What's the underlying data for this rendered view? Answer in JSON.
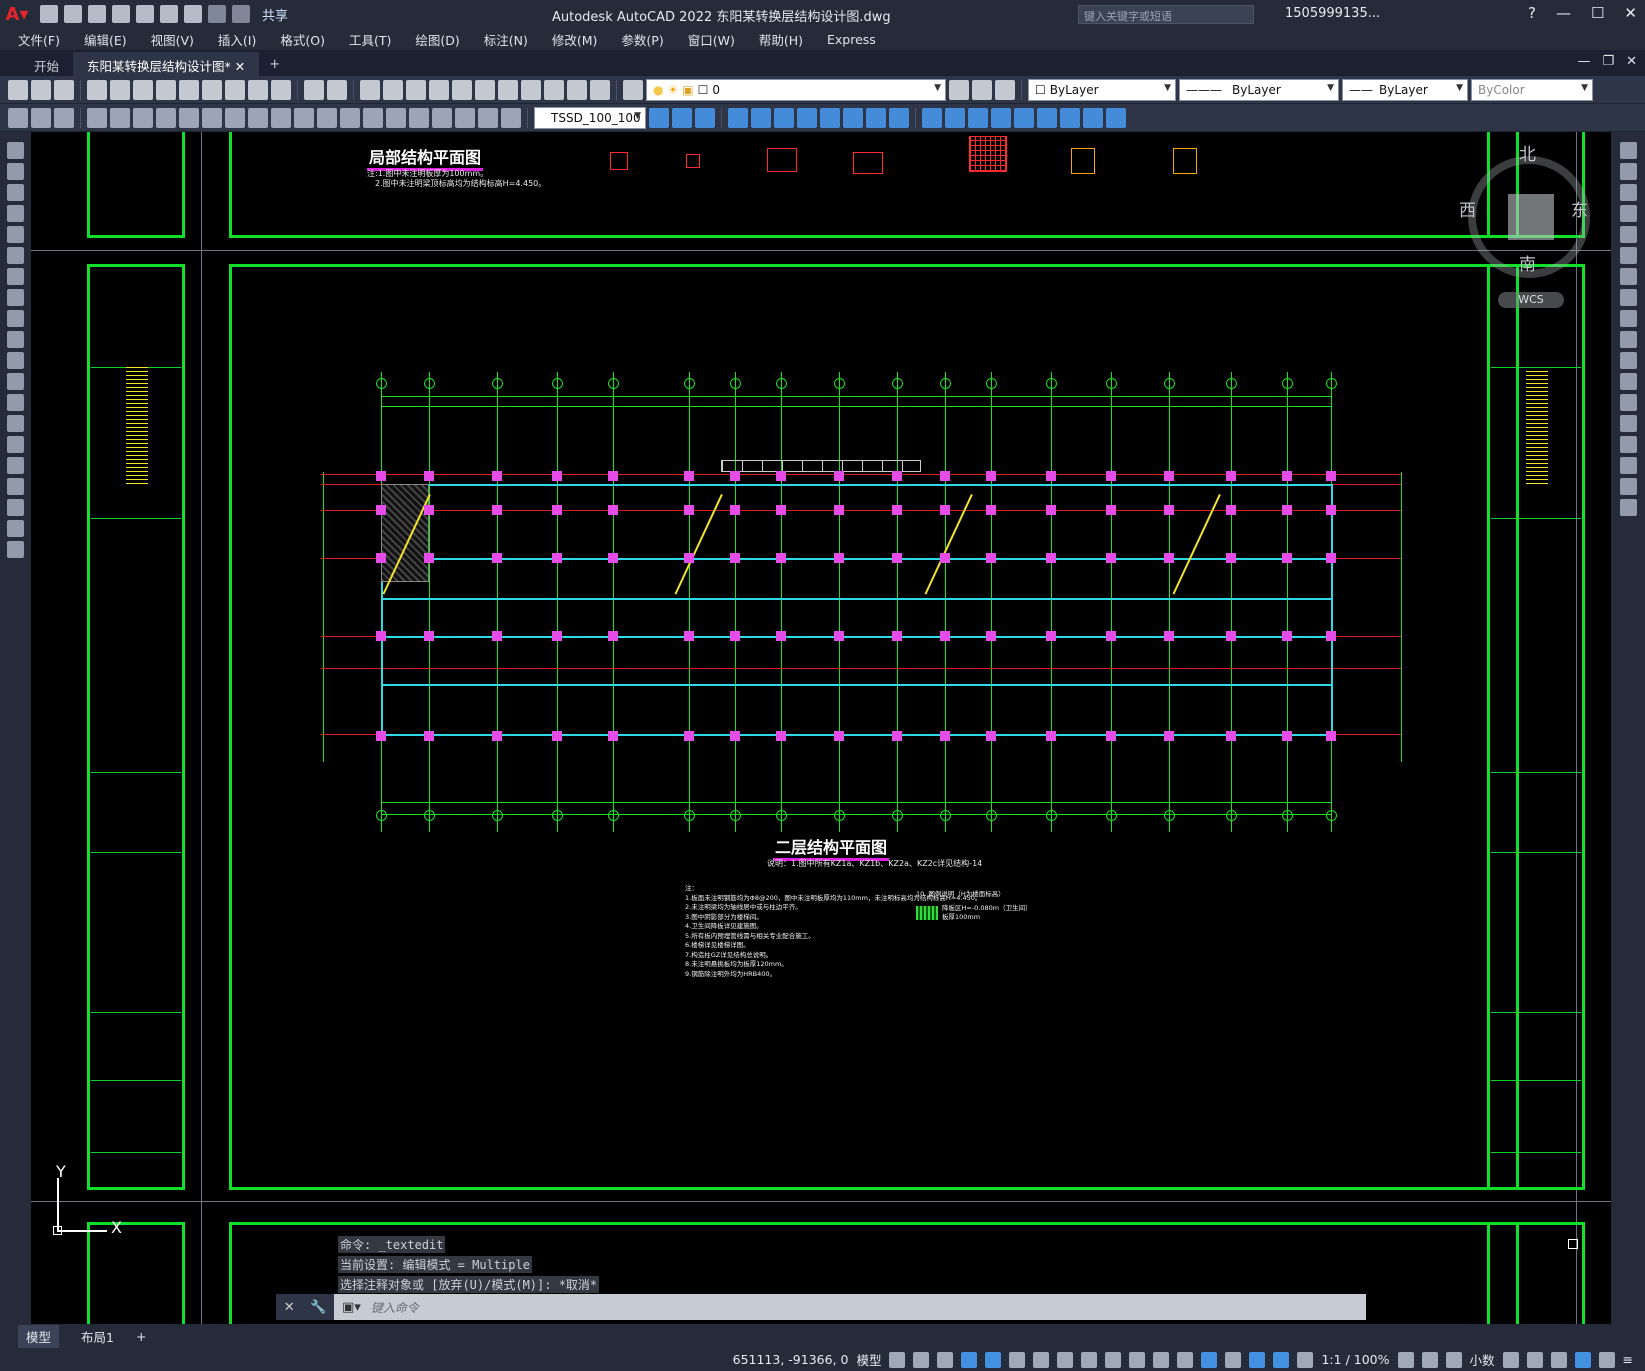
{
  "app": {
    "title": "Autodesk AutoCAD 2022    东阳某转换层结构设计图.dwg",
    "share": "共享",
    "search_placeholder": "键入关键字或短语",
    "user": "1505999135..."
  },
  "menu": [
    "文件(F)",
    "编辑(E)",
    "视图(V)",
    "插入(I)",
    "格式(O)",
    "工具(T)",
    "绘图(D)",
    "标注(N)",
    "修改(M)",
    "参数(P)",
    "窗口(W)",
    "帮助(H)",
    "Express"
  ],
  "tabs": {
    "start": "开始",
    "doc": "东阳某转换层结构设计图*"
  },
  "toolbar": {
    "layer": "0",
    "color": "ByLayer",
    "linetype": "ByLayer",
    "lineweight": "ByLayer",
    "plotstyle": "ByColor",
    "textstyle": "TSSD_100_100"
  },
  "viewcube": {
    "north": "北",
    "south": "南",
    "east": "东",
    "west": "西",
    "wcs": "WCS"
  },
  "drawing": {
    "partial_title": "局部结构平面图",
    "partial_note1": "注:1.图中未注明板厚为100mm。",
    "partial_note2": "2.图中未注明梁顶标高均为结构标高H=4.450。",
    "main_title": "二层结构平面图",
    "main_sub": "说明：1.图中所有KZ1a、KZ1b、KZ2a、KZ2c详见结构-14",
    "notes_header": "注：",
    "notes": [
      "1.板面未注明钢筋均为Φ8@200，图中未注明板厚均为110mm，未注明标高均为结构标高H=4.450。",
      "2.未注明梁均为轴线居中或与柱边平齐。",
      "3.图中阴影部分为楼梯间。",
      "4.卫生间降板详见建施图。",
      "5.所有板内预埋管线需与相关专业配合施工。",
      "6.楼梯详见楼梯详图。",
      "7.构造柱GZ详见结构总说明。",
      "8.未注明悬挑板均为板厚120mm。",
      "9.钢筋除注明外均为HRB400。"
    ],
    "legend_no": "10.",
    "legend_title": "图例说明（H为楼面标高）",
    "legend_text1": "降板区H=-0.080m（卫生间）",
    "legend_text2": "板厚100mm"
  },
  "command": {
    "history": [
      "命令: _textedit",
      "当前设置: 编辑模式 = Multiple",
      "选择注释对象或 [放弃(U)/模式(M)]: *取消*"
    ],
    "placeholder": "键入命令"
  },
  "layouts": {
    "model": "模型",
    "layout1": "布局1"
  },
  "status": {
    "coords": "651113, -91366, 0",
    "mode": "模型",
    "scale": "1:1 / 100%",
    "units": "小数"
  }
}
